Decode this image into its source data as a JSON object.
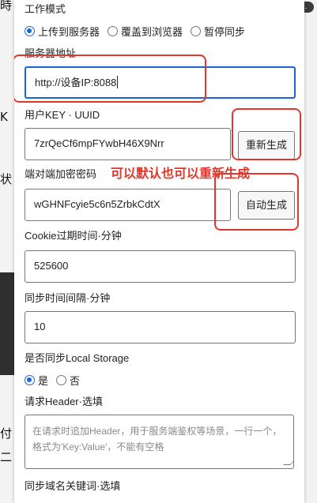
{
  "background": {
    "badge": "…",
    "edge_glyphs": [
      "時",
      "K",
      "状",
      "付",
      "二"
    ]
  },
  "work_mode": {
    "label": "工作模式",
    "options": [
      "上传到服务器",
      "覆盖到浏览器",
      "暂停同步"
    ],
    "selected": "上传到服务器"
  },
  "server_address": {
    "label": "服务器地址",
    "value": "http://设备IP:8088"
  },
  "user_key": {
    "label": "用户KEY · UUID",
    "value": "7zrQeCf6mpFYwbH46X9Nrr",
    "button_label": "重新生成"
  },
  "e2e_password": {
    "label": "端对端加密密码",
    "value": "wGHNFcyie5c6n5ZrbkCdtX",
    "button_label": "自动生成"
  },
  "cookie_expiry": {
    "label": "Cookie过期时间·分钟",
    "value": "525600"
  },
  "sync_interval": {
    "label": "同步时间间隔·分钟",
    "value": "10"
  },
  "local_storage_sync": {
    "label": "是否同步Local Storage",
    "options": [
      "是",
      "否"
    ],
    "selected": "是"
  },
  "request_header": {
    "label": "请求Header·选填",
    "placeholder": "在请求时追加Header，用于服务端鉴权等场景，一行一个，格式为'Key:Value'，不能有空格"
  },
  "sync_domain_keywords": {
    "label": "同步域名关键词·选填"
  },
  "annotation": {
    "text": "可以默认也可以重新生成",
    "color": "#e3362a"
  },
  "colors": {
    "accent": "#1766d6",
    "annotation": "#e3362a"
  }
}
